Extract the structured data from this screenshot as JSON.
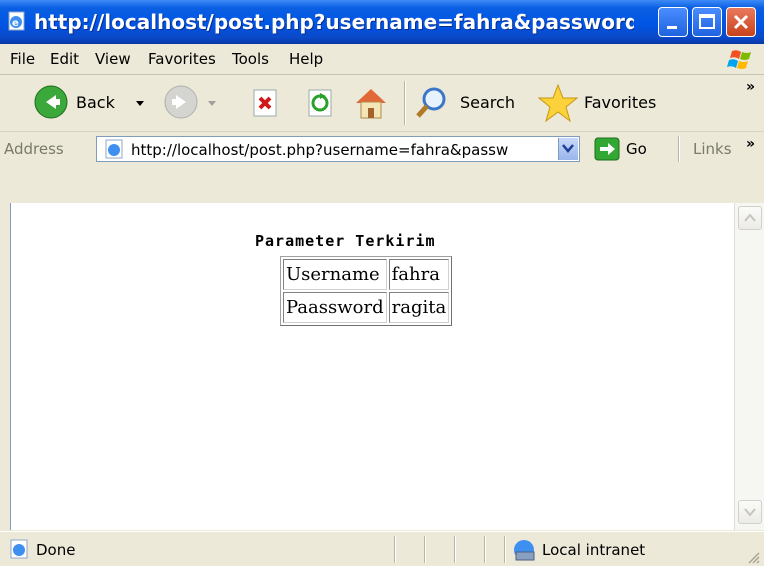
{
  "window": {
    "title": "http://localhost/post.php?username=fahra&password...",
    "caption_buttons": [
      "minimize",
      "maximize",
      "close"
    ]
  },
  "menu": {
    "items": [
      "File",
      "Edit",
      "View",
      "Favorites",
      "Tools",
      "Help"
    ]
  },
  "toolbar": {
    "back_label": "Back",
    "search_label": "Search",
    "favorites_label": "Favorites",
    "overflow": "»"
  },
  "address_bar": {
    "label": "Address",
    "url": "http://localhost/post.php?username=fahra&passw",
    "go_label": "Go",
    "links_label": "Links",
    "overflow": "»"
  },
  "page": {
    "heading": "Parameter Terkirim",
    "rows": [
      {
        "field": "Username",
        "value": "fahra"
      },
      {
        "field": "Paassword",
        "value": "ragita"
      }
    ]
  },
  "status": {
    "text": "Done",
    "zone": "Local intranet"
  },
  "colors": {
    "titlebar": "#0055e5",
    "chrome": "#ece9d8",
    "close_button": "#c9421b",
    "content_bg": "#ffffff"
  }
}
